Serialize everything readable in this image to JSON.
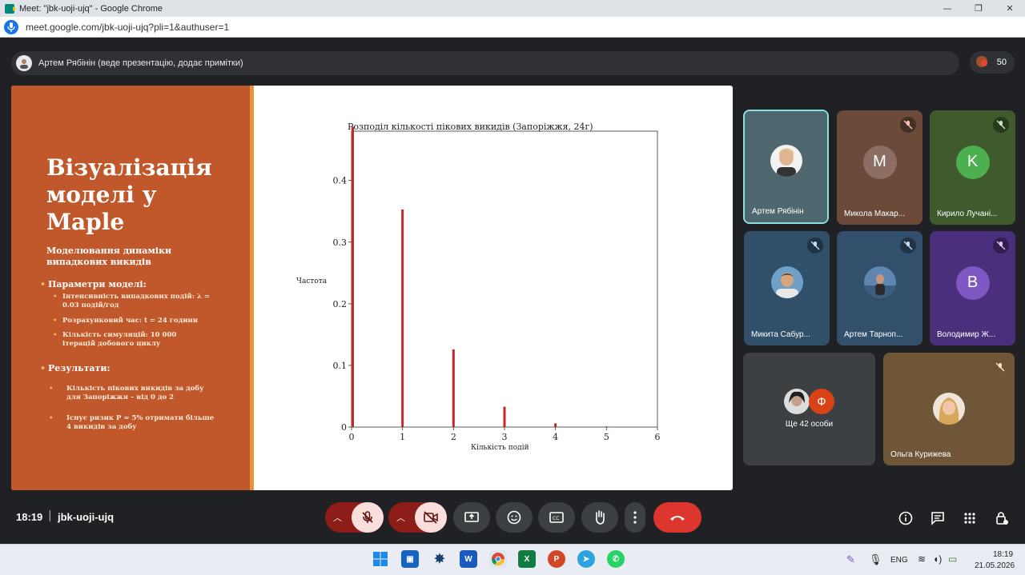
{
  "window": {
    "title": "Meet: \"jbk-uoji-ujq\" - Google Chrome",
    "url": "meet.google.com/jbk-uoji-ujq?pli=1&authuser=1"
  },
  "presenter": {
    "text": "Артем Рябінін (веде презентацію, додає примітки)"
  },
  "participants_count": "50",
  "slide": {
    "title": "Візуалізація моделі у Maple",
    "subtitle": "Моделювання динаміки випадкових викидів",
    "params_heading": "Параметри моделі:",
    "params": [
      "Інтенсивність випадкових подій: λ = 0.03 подій/год",
      "Розрахунковий час: t = 24 години",
      "Кількість симуляцій: 10 000 ітерацій добового циклу"
    ],
    "results_heading": "Результати:",
    "results": [
      "Кількість пікових викидів за добу для Запоріжжя – від 0 до 2",
      "Існує ризик P ≈ 5% отримати більше 4 викидів за добу"
    ]
  },
  "chart_data": {
    "type": "bar",
    "title": "Розподіл кількості пікових викидів (Запоріжжя, 24г)",
    "xlabel": "Кількість подій",
    "ylabel": "Частота",
    "x": [
      0,
      1,
      2,
      3,
      4,
      5
    ],
    "values": [
      0.487,
      0.353,
      0.126,
      0.033,
      0.006,
      0.001
    ],
    "xlim": [
      0,
      6
    ],
    "ylim": [
      0,
      0.48
    ],
    "xticks": [
      "0",
      "1",
      "2",
      "3",
      "4",
      "5",
      "6"
    ],
    "yticks": [
      "0",
      "0.1",
      "0.2",
      "0.3",
      "0.4"
    ],
    "bar_color": "#c0282b"
  },
  "tiles": [
    {
      "name": "Артем Рябінін",
      "bg": "#4f6870",
      "muted": false,
      "active": true
    },
    {
      "name": "Микола Макар...",
      "letter": "M",
      "letter_bg": "#8d6e63",
      "bg": "#6b4a3a",
      "muted": true
    },
    {
      "name": "Кирило Лучані...",
      "letter": "K",
      "letter_bg": "#4caf50",
      "bg": "#3f5a2c",
      "muted": true
    },
    {
      "name": "Микита Сабур...",
      "bg": "#2f5068",
      "muted": true
    },
    {
      "name": "Артем Тарноп...",
      "bg": "#32506b",
      "muted": true
    },
    {
      "name": "Володимир Ж...",
      "letter": "B",
      "letter_bg": "#7e57c2",
      "bg": "#4a2f7c",
      "muted": true
    }
  ],
  "others": {
    "label": "Ще 42 особи",
    "letter": "Ф"
  },
  "olga": {
    "name": "Ольга Курижева"
  },
  "meeting": {
    "time": "18:19",
    "code": "jbk-uoji-ujq"
  },
  "tray": {
    "lang": "ENG",
    "time": "18:19",
    "date": "21.05.2026"
  }
}
